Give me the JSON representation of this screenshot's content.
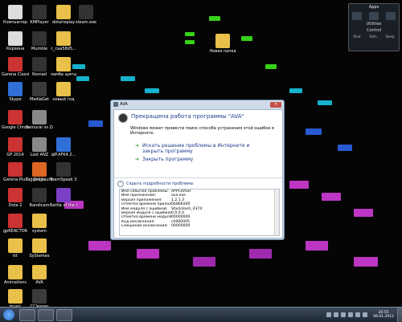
{
  "desktop": {
    "icons": [
      {
        "label": "Компьютер",
        "glyph": "computer-icon",
        "color": "#dddddd"
      },
      {
        "label": "KMPlayer",
        "glyph": "kmplayer-icon",
        "color": "#333333"
      },
      {
        "label": "dotaireplay",
        "glyph": "folder-icon",
        "color": "#e8c04a"
      },
      {
        "label": "steam.exe",
        "glyph": "steam-icon",
        "color": "#333333"
      },
      {
        "label": "Корзина",
        "glyph": "recycle-bin-icon",
        "color": "#dddddd"
      },
      {
        "label": "Mumble",
        "glyph": "mumble-icon",
        "color": "#333333"
      },
      {
        "label": "c_caa58d5...",
        "glyph": "folder-icon",
        "color": "#e8c04a"
      },
      {
        "label": "Новая папка",
        "glyph": "folder-icon",
        "color": "#e8c04a"
      },
      {
        "label": "Garena Classic",
        "glyph": "garena-icon",
        "color": "#cc3333"
      },
      {
        "label": "Nomad",
        "glyph": "nomad-icon",
        "color": "#333333"
      },
      {
        "label": "ламба щяты",
        "glyph": "folder-icon",
        "color": "#e8c04a"
      },
      {
        "label": "Skype",
        "glyph": "skype-icon",
        "color": "#2f6fd6"
      },
      {
        "label": "MediaGet",
        "glyph": "mediaget-icon",
        "color": "#3b3b3b"
      },
      {
        "label": "новый год",
        "glyph": "folder-icon",
        "color": "#e8c04a"
      },
      {
        "label": "Google Chrome",
        "glyph": "chrome-icon",
        "color": "#cc3333"
      },
      {
        "label": "Samurai vs Zombies 2",
        "glyph": "game-icon",
        "color": "#888888"
      },
      {
        "label": "GP 2014",
        "glyph": "game-icon",
        "color": "#cc3333"
      },
      {
        "label": "Lost ANZ",
        "glyph": "game-icon",
        "color": "#888888"
      },
      {
        "label": "qIP.AFK4.2...",
        "glyph": "qip-icon",
        "color": "#2f6fd6"
      },
      {
        "label": "Tagged Launcher",
        "glyph": "launcher-icon",
        "color": "#333333"
      },
      {
        "label": "Garena Plus",
        "glyph": "garena-icon",
        "color": "#cc3333"
      },
      {
        "label": "Origin",
        "glyph": "origin-icon",
        "color": "#dd6622"
      },
      {
        "label": "TeamSpeak 3 Client",
        "glyph": "teamspeak-icon",
        "color": "#333333"
      },
      {
        "label": "Dota 2",
        "glyph": "dota-icon",
        "color": "#cc3333"
      },
      {
        "label": "Bandicam",
        "glyph": "bandicam-icon",
        "color": "#333333"
      },
      {
        "label": "Battle of the Immortals",
        "glyph": "game-icon",
        "color": "#7a3fc4"
      },
      {
        "label": "gpREACTOR",
        "glyph": "reactor-icon",
        "color": "#cc3333"
      },
      {
        "label": "system",
        "glyph": "folder-icon",
        "color": "#e8c04a"
      },
      {
        "label": "ttt",
        "glyph": "folder-icon",
        "color": "#e8c04a"
      },
      {
        "label": "SyStemes",
        "glyph": "folder-icon",
        "color": "#e8c04a"
      },
      {
        "label": "Animations",
        "glyph": "folder-icon",
        "color": "#e8c04a"
      },
      {
        "label": "AVA",
        "glyph": "ava-icon",
        "color": "#e8c04a"
      },
      {
        "label": "music",
        "glyph": "folder-icon",
        "color": "#e8c04a"
      },
      {
        "label": "CCleaner",
        "glyph": "ccleaner-icon",
        "color": "#3b3b3b"
      }
    ]
  },
  "gadget": {
    "title": "Apps",
    "label1": "Utilities",
    "label2": "Control",
    "footer": [
      "Shut",
      "Stdn",
      "Sleep"
    ]
  },
  "dialog": {
    "window_title": "AVA",
    "heading": "Прекращена работа программы \"AVA\"",
    "message": "Windows может провести поиск способа устранения этой ошибки в Интернете.",
    "option1": "Искать решение проблемы в Интернете и закрыть программу",
    "option2": "Закрыть программу",
    "details_label": "Скрыть подробности проблемы",
    "details": [
      {
        "k": "Имя события проблемы:",
        "v": "APPCRASH"
      },
      {
        "k": "Имя приложения:",
        "v": "ava.exe"
      },
      {
        "k": "Версия приложения:",
        "v": "1.2.1.3"
      },
      {
        "k": "Отметка времени приложения:",
        "v": "5b866d40"
      },
      {
        "k": "Имя модуля с ошибкой:",
        "v": "StackHash_4374"
      },
      {
        "k": "Версия модуля с ошибкой:",
        "v": "0.0.0.0"
      },
      {
        "k": "Отметка времени модуля с ошибкой:",
        "v": "00000000"
      },
      {
        "k": "Код исключения:",
        "v": "c0000005"
      },
      {
        "k": "Смещение исключения:",
        "v": "00000000"
      }
    ]
  },
  "taskbar": {
    "clock_time": "20:55",
    "clock_date": "08.01.2012"
  },
  "colors": {
    "bar_cyan": "#18c7e6",
    "bar_green": "#3ee81d",
    "bar_magenta": "#d13bd8",
    "bar_blue": "#2b63e8"
  }
}
